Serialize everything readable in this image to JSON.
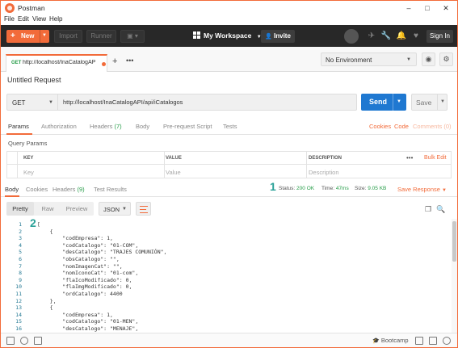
{
  "app": {
    "title": "Postman"
  },
  "window_controls": {
    "minimize": "–",
    "maximize": "□",
    "close": "✕"
  },
  "menu": [
    "File",
    "Edit",
    "View",
    "Help"
  ],
  "header": {
    "new_label": "New",
    "import_label": "Import",
    "runner_label": "Runner",
    "workspace_label": "My Workspace",
    "invite_label": "Invite",
    "signin_label": "Sign In"
  },
  "tab": {
    "method": "GET",
    "url": "http://localhost/InaCatalogAPI/..."
  },
  "environment": {
    "selected": "No Environment"
  },
  "request": {
    "title": "Untitled Request",
    "method": "GET",
    "url": "http://localhost/InaCatalogAPI/api/iCatalogos",
    "send_label": "Send",
    "save_label": "Save"
  },
  "request_tabs": {
    "params": "Params",
    "authorization": "Authorization",
    "headers": "Headers",
    "headers_count": "(7)",
    "body": "Body",
    "prerequest": "Pre-request Script",
    "tests": "Tests",
    "cookies": "Cookies",
    "code": "Code",
    "comments": "Comments (0)"
  },
  "query_params": {
    "title": "Query Params",
    "columns": [
      "KEY",
      "VALUE",
      "DESCRIPTION"
    ],
    "placeholders": [
      "Key",
      "Value",
      "Description"
    ],
    "more": "•••",
    "bulk_edit": "Bulk Edit"
  },
  "response": {
    "tabs": {
      "body": "Body",
      "cookies": "Cookies",
      "headers": "Headers",
      "headers_count": "(9)",
      "tests": "Test Results"
    },
    "status_label": "Status:",
    "status_value": "200 OK",
    "time_label": "Time:",
    "time_value": "47ms",
    "size_label": "Size:",
    "size_value": "9.05 KB",
    "save_response": "Save Response"
  },
  "annotations": {
    "one": "1",
    "two": "2"
  },
  "response_toolbar": {
    "formats": [
      "Pretty",
      "Raw",
      "Preview"
    ],
    "active_format": "Pretty",
    "language": "JSON"
  },
  "code_lines": [
    {
      "n": "1",
      "t": "["
    },
    {
      "n": "2",
      "t": "    {"
    },
    {
      "n": "3",
      "t": "        \"codEmpresa\": 1,"
    },
    {
      "n": "4",
      "t": "        \"codCatalogo\": \"01-COM\","
    },
    {
      "n": "5",
      "t": "        \"desCatalogo\": \"TRAJES COMUNIÓN\","
    },
    {
      "n": "6",
      "t": "        \"obsCatalogo\": \"\","
    },
    {
      "n": "7",
      "t": "        \"nomImagenCat\": \"\","
    },
    {
      "n": "8",
      "t": "        \"nomIconoCat\": \"01-com\","
    },
    {
      "n": "9",
      "t": "        \"flaIcoModificado\": 0,"
    },
    {
      "n": "10",
      "t": "        \"flaImgModificado\": 0,"
    },
    {
      "n": "11",
      "t": "        \"ordCatalogo\": 4400"
    },
    {
      "n": "12",
      "t": "    },"
    },
    {
      "n": "13",
      "t": "    {"
    },
    {
      "n": "14",
      "t": "        \"codEmpresa\": 1,"
    },
    {
      "n": "15",
      "t": "        \"codCatalogo\": \"01-MEN\","
    },
    {
      "n": "16",
      "t": "        \"desCatalogo\": \"MENAJE\","
    }
  ],
  "statusbar": {
    "bootcamp": "Bootcamp"
  },
  "colors": {
    "accent": "#f26b3a",
    "send": "#1f78d1",
    "status_ok": "#259c47",
    "header_bg": "#282828"
  }
}
